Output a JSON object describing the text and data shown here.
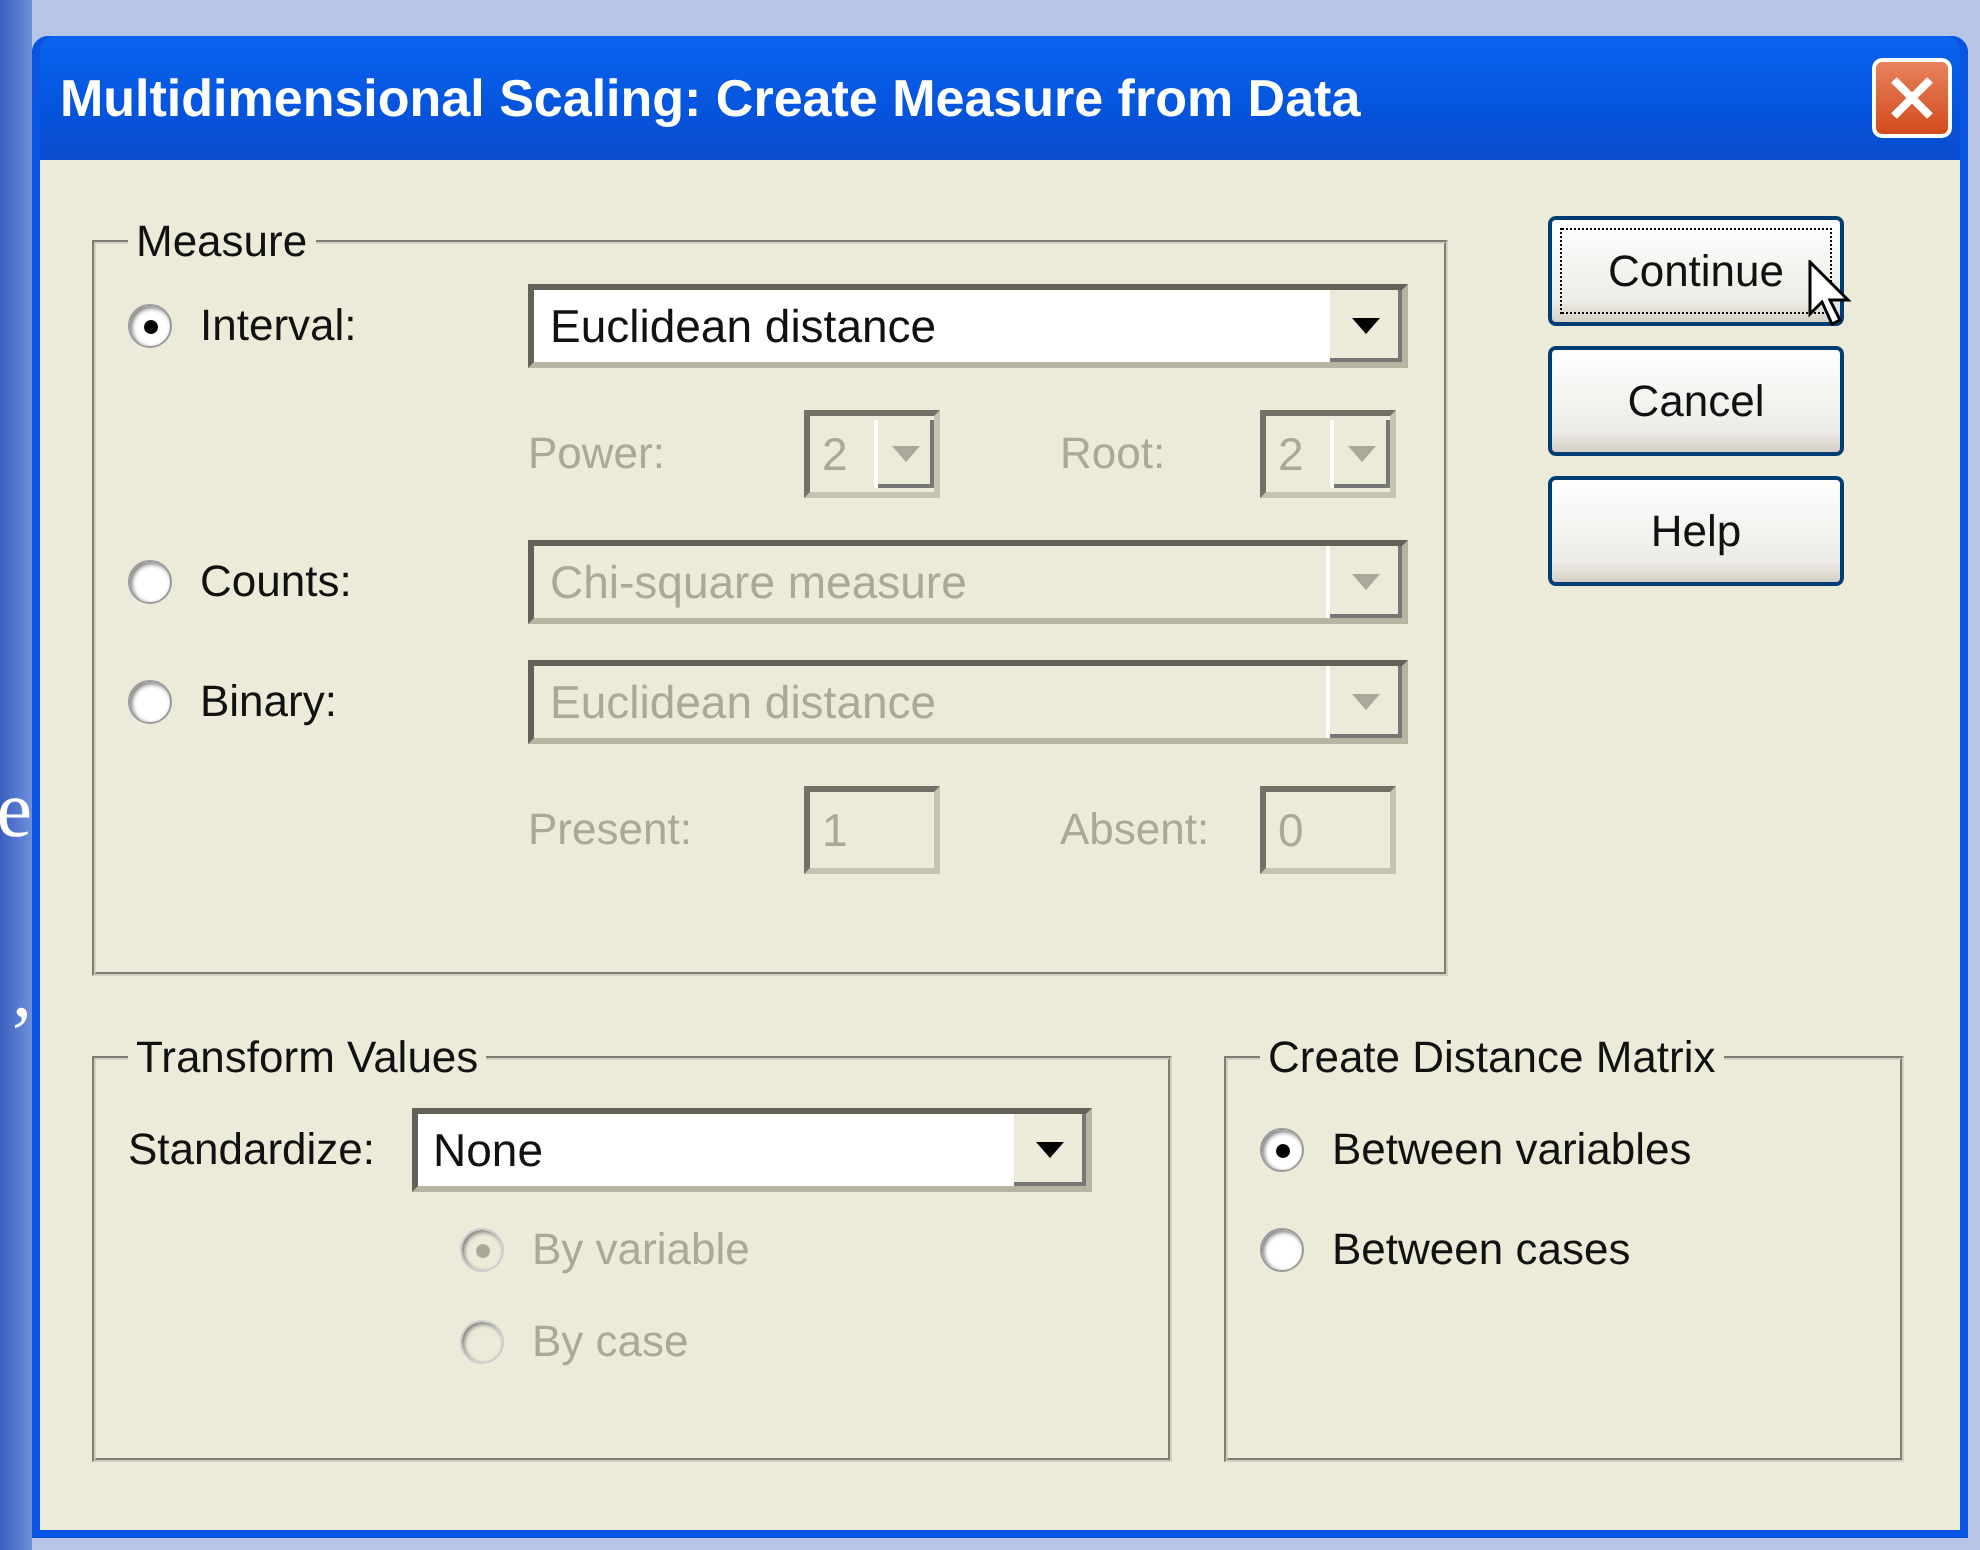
{
  "slide_fragments": [
    "e",
    ","
  ],
  "window": {
    "title": "Multidimensional Scaling: Create Measure from Data"
  },
  "measure": {
    "title": "Measure",
    "options": [
      {
        "label": "Interval:",
        "selected": true,
        "combo": {
          "value": "Euclidean distance",
          "disabled": false
        },
        "params": [
          {
            "label": "Power:",
            "value": "2",
            "kind": "spin",
            "disabled": true
          },
          {
            "label": "Root:",
            "value": "2",
            "kind": "spin",
            "disabled": true
          }
        ]
      },
      {
        "label": "Counts:",
        "selected": false,
        "combo": {
          "value": "Chi-square measure",
          "disabled": true
        }
      },
      {
        "label": "Binary:",
        "selected": false,
        "combo": {
          "value": "Euclidean distance",
          "disabled": true
        },
        "params": [
          {
            "label": "Present:",
            "value": "1",
            "kind": "field",
            "disabled": true
          },
          {
            "label": "Absent:",
            "value": "0",
            "kind": "field",
            "disabled": true
          }
        ]
      }
    ]
  },
  "buttons": [
    {
      "label": "Continue",
      "focused": true
    },
    {
      "label": "Cancel",
      "focused": false
    },
    {
      "label": "Help",
      "focused": false
    }
  ],
  "transform": {
    "title": "Transform Values",
    "standardize_label": "Standardize:",
    "standardize_value": "None",
    "options": [
      {
        "label": "By variable",
        "selected": true,
        "disabled": true
      },
      {
        "label": "By case",
        "selected": false,
        "disabled": true
      }
    ]
  },
  "matrix": {
    "title": "Create Distance Matrix",
    "options": [
      {
        "label": "Between variables",
        "selected": true
      },
      {
        "label": "Between cases",
        "selected": false
      }
    ]
  }
}
